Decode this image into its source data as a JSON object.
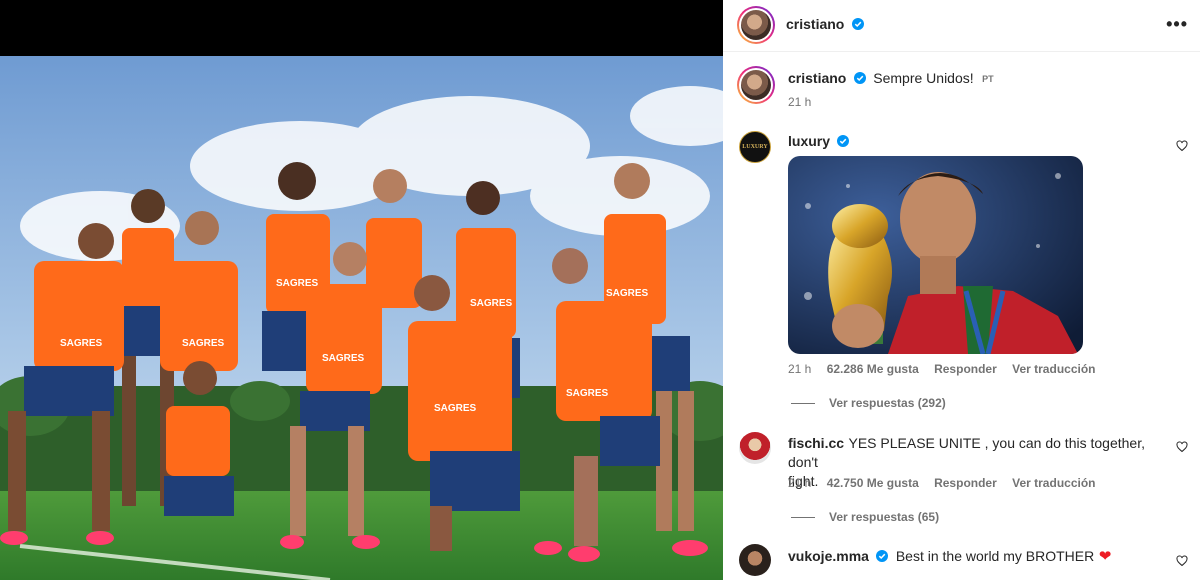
{
  "post": {
    "author": "cristiano",
    "caption": "Sempre Unidos!",
    "caption_lang": "PT",
    "time": "21 h",
    "more_label": "•••"
  },
  "comments": [
    {
      "user": "luxury",
      "time": "21 h",
      "likes": "62.286 Me gusta",
      "reply_label": "Responder",
      "translate_label": "Ver traducción",
      "view_replies": "Ver respuestas (292)",
      "avatar_text": "LUXURY"
    },
    {
      "user": "fischi.cc",
      "text_line1": "YES PLEASE UNITE , you can do this together, don't",
      "text_line2": "fight.",
      "time": "21 h",
      "likes": "42.750 Me gusta",
      "reply_label": "Responder",
      "translate_label": "Ver traducción",
      "view_replies": "Ver respuestas (65)"
    },
    {
      "user": "vukoje.mma",
      "text": "Best in the world my BROTHER",
      "emoji": "❤"
    }
  ],
  "photo": {
    "sponsor_text": "SAGRES"
  },
  "colors": {
    "verified": "#0095f6",
    "bib": "#ff6a1a",
    "heart_emoji": "#ed1c24"
  }
}
